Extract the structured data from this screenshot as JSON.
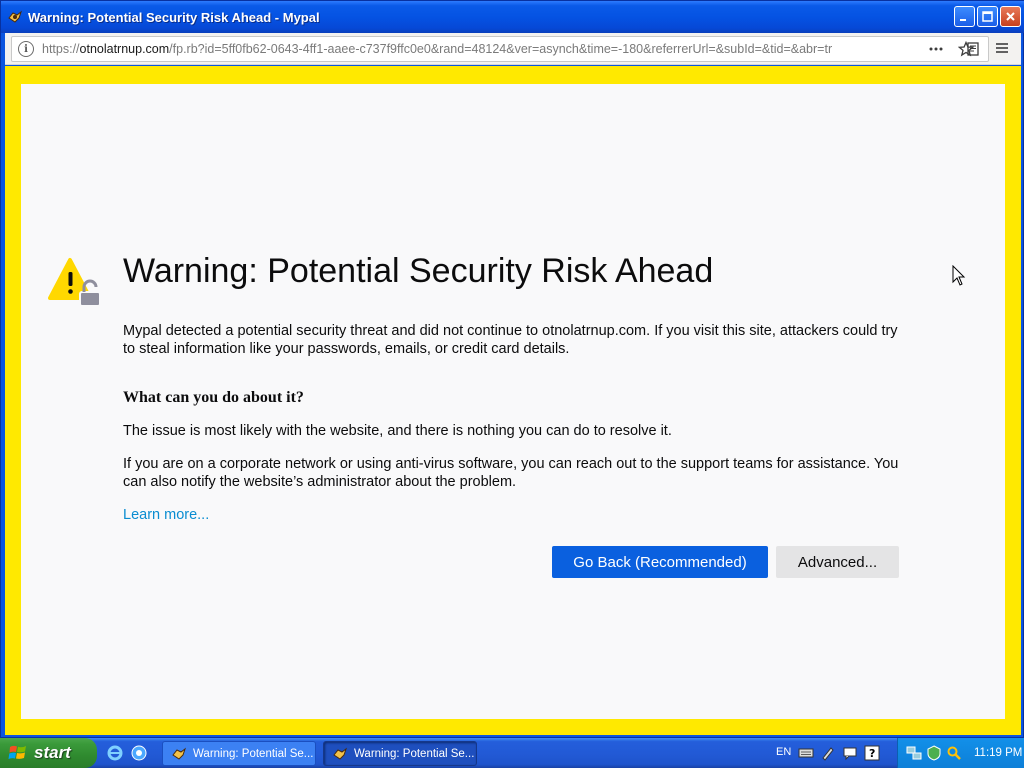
{
  "window": {
    "title": "Warning: Potential Security Risk Ahead - Mypal"
  },
  "toolbar": {
    "url_prefix": "https://",
    "url_host": "otnolatrnup.com",
    "url_path": "/fp.rb?id=5ff0fb62-0643-4ff1-aaee-c737f9ffc0e0&rand=48124&ver=asynch&time=-180&referrerUrl=&subId=&tid=&abr=tr",
    "icons": [
      "info-icon",
      "reader-view-icon",
      "more-actions-icon",
      "bookmark-star-icon",
      "hamburger-menu-icon"
    ]
  },
  "page": {
    "headline": "Warning: Potential Security Risk Ahead",
    "description": "Mypal detected a potential security threat and did not continue to otnolatrnup.com. If you visit this site, attackers could try to steal information like your passwords, emails, or credit card details.",
    "subheading": "What can you do about it?",
    "para1": "The issue is most likely with the website, and there is nothing you can do to resolve it.",
    "para2": "If you are on a corporate network or using anti-virus software, you can reach out to the support teams for assistance. You can also notify the website’s administrator about the problem.",
    "learn_more": "Learn more...",
    "go_back_label": "Go Back (Recommended)",
    "advanced_label": "Advanced..."
  },
  "taskbar": {
    "start_label": "start",
    "tasks": [
      {
        "label": "Warning: Potential Se..."
      },
      {
        "label": "Warning: Potential Se..."
      }
    ],
    "language": "EN",
    "clock": "11:19 PM"
  },
  "colors": {
    "page_border": "#ffe900",
    "primary_button": "#0a60df",
    "link": "#0a8dd1",
    "warning_yellow": "#ffd800"
  }
}
